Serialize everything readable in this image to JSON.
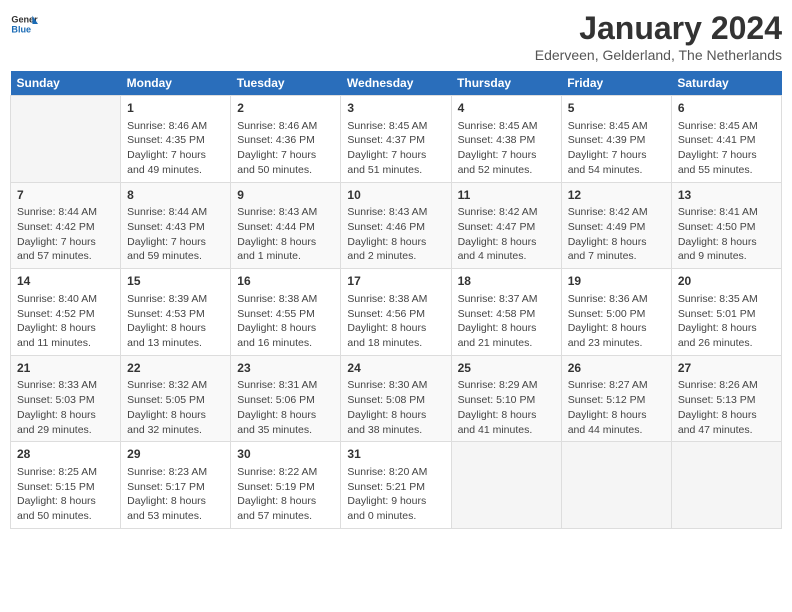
{
  "logo": {
    "line1": "General",
    "line2": "Blue"
  },
  "title": "January 2024",
  "subtitle": "Ederveen, Gelderland, The Netherlands",
  "weekdays": [
    "Sunday",
    "Monday",
    "Tuesday",
    "Wednesday",
    "Thursday",
    "Friday",
    "Saturday"
  ],
  "weeks": [
    [
      {
        "day": "",
        "info": ""
      },
      {
        "day": "1",
        "info": "Sunrise: 8:46 AM\nSunset: 4:35 PM\nDaylight: 7 hours\nand 49 minutes."
      },
      {
        "day": "2",
        "info": "Sunrise: 8:46 AM\nSunset: 4:36 PM\nDaylight: 7 hours\nand 50 minutes."
      },
      {
        "day": "3",
        "info": "Sunrise: 8:45 AM\nSunset: 4:37 PM\nDaylight: 7 hours\nand 51 minutes."
      },
      {
        "day": "4",
        "info": "Sunrise: 8:45 AM\nSunset: 4:38 PM\nDaylight: 7 hours\nand 52 minutes."
      },
      {
        "day": "5",
        "info": "Sunrise: 8:45 AM\nSunset: 4:39 PM\nDaylight: 7 hours\nand 54 minutes."
      },
      {
        "day": "6",
        "info": "Sunrise: 8:45 AM\nSunset: 4:41 PM\nDaylight: 7 hours\nand 55 minutes."
      }
    ],
    [
      {
        "day": "7",
        "info": "Sunrise: 8:44 AM\nSunset: 4:42 PM\nDaylight: 7 hours\nand 57 minutes."
      },
      {
        "day": "8",
        "info": "Sunrise: 8:44 AM\nSunset: 4:43 PM\nDaylight: 7 hours\nand 59 minutes."
      },
      {
        "day": "9",
        "info": "Sunrise: 8:43 AM\nSunset: 4:44 PM\nDaylight: 8 hours\nand 1 minute."
      },
      {
        "day": "10",
        "info": "Sunrise: 8:43 AM\nSunset: 4:46 PM\nDaylight: 8 hours\nand 2 minutes."
      },
      {
        "day": "11",
        "info": "Sunrise: 8:42 AM\nSunset: 4:47 PM\nDaylight: 8 hours\nand 4 minutes."
      },
      {
        "day": "12",
        "info": "Sunrise: 8:42 AM\nSunset: 4:49 PM\nDaylight: 8 hours\nand 7 minutes."
      },
      {
        "day": "13",
        "info": "Sunrise: 8:41 AM\nSunset: 4:50 PM\nDaylight: 8 hours\nand 9 minutes."
      }
    ],
    [
      {
        "day": "14",
        "info": "Sunrise: 8:40 AM\nSunset: 4:52 PM\nDaylight: 8 hours\nand 11 minutes."
      },
      {
        "day": "15",
        "info": "Sunrise: 8:39 AM\nSunset: 4:53 PM\nDaylight: 8 hours\nand 13 minutes."
      },
      {
        "day": "16",
        "info": "Sunrise: 8:38 AM\nSunset: 4:55 PM\nDaylight: 8 hours\nand 16 minutes."
      },
      {
        "day": "17",
        "info": "Sunrise: 8:38 AM\nSunset: 4:56 PM\nDaylight: 8 hours\nand 18 minutes."
      },
      {
        "day": "18",
        "info": "Sunrise: 8:37 AM\nSunset: 4:58 PM\nDaylight: 8 hours\nand 21 minutes."
      },
      {
        "day": "19",
        "info": "Sunrise: 8:36 AM\nSunset: 5:00 PM\nDaylight: 8 hours\nand 23 minutes."
      },
      {
        "day": "20",
        "info": "Sunrise: 8:35 AM\nSunset: 5:01 PM\nDaylight: 8 hours\nand 26 minutes."
      }
    ],
    [
      {
        "day": "21",
        "info": "Sunrise: 8:33 AM\nSunset: 5:03 PM\nDaylight: 8 hours\nand 29 minutes."
      },
      {
        "day": "22",
        "info": "Sunrise: 8:32 AM\nSunset: 5:05 PM\nDaylight: 8 hours\nand 32 minutes."
      },
      {
        "day": "23",
        "info": "Sunrise: 8:31 AM\nSunset: 5:06 PM\nDaylight: 8 hours\nand 35 minutes."
      },
      {
        "day": "24",
        "info": "Sunrise: 8:30 AM\nSunset: 5:08 PM\nDaylight: 8 hours\nand 38 minutes."
      },
      {
        "day": "25",
        "info": "Sunrise: 8:29 AM\nSunset: 5:10 PM\nDaylight: 8 hours\nand 41 minutes."
      },
      {
        "day": "26",
        "info": "Sunrise: 8:27 AM\nSunset: 5:12 PM\nDaylight: 8 hours\nand 44 minutes."
      },
      {
        "day": "27",
        "info": "Sunrise: 8:26 AM\nSunset: 5:13 PM\nDaylight: 8 hours\nand 47 minutes."
      }
    ],
    [
      {
        "day": "28",
        "info": "Sunrise: 8:25 AM\nSunset: 5:15 PM\nDaylight: 8 hours\nand 50 minutes."
      },
      {
        "day": "29",
        "info": "Sunrise: 8:23 AM\nSunset: 5:17 PM\nDaylight: 8 hours\nand 53 minutes."
      },
      {
        "day": "30",
        "info": "Sunrise: 8:22 AM\nSunset: 5:19 PM\nDaylight: 8 hours\nand 57 minutes."
      },
      {
        "day": "31",
        "info": "Sunrise: 8:20 AM\nSunset: 5:21 PM\nDaylight: 9 hours\nand 0 minutes."
      },
      {
        "day": "",
        "info": ""
      },
      {
        "day": "",
        "info": ""
      },
      {
        "day": "",
        "info": ""
      }
    ]
  ]
}
